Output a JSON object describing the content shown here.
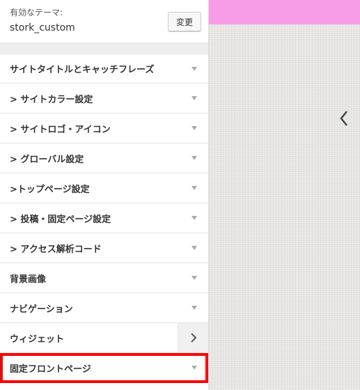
{
  "theme": {
    "label": "有効なテーマ:",
    "name": "stork_custom",
    "change_button": "変更"
  },
  "menu": {
    "items": [
      {
        "label": "サイトタイトルとキャッチフレーズ",
        "indicator": "arrow-down"
      },
      {
        "label": "> サイトカラー設定",
        "indicator": "arrow-down"
      },
      {
        "label": "> サイトロゴ・アイコン",
        "indicator": "arrow-down"
      },
      {
        "label": "> グローバル設定",
        "indicator": "arrow-down"
      },
      {
        "label": ">トップページ設定",
        "indicator": "arrow-down"
      },
      {
        "label": "> 投稿・固定ページ設定",
        "indicator": "arrow-down"
      },
      {
        "label": "> アクセス解析コード",
        "indicator": "arrow-down"
      },
      {
        "label": "背景画像",
        "indicator": "arrow-down"
      },
      {
        "label": "ナビゲーション",
        "indicator": "arrow-down"
      },
      {
        "label": "ウィジェット",
        "indicator": "chevron-right"
      },
      {
        "label": "固定フロントページ",
        "indicator": "arrow-down",
        "highlighted": true
      }
    ]
  },
  "colors": {
    "header_pink": "#f79ce6",
    "highlight_red": "#ff0000"
  }
}
